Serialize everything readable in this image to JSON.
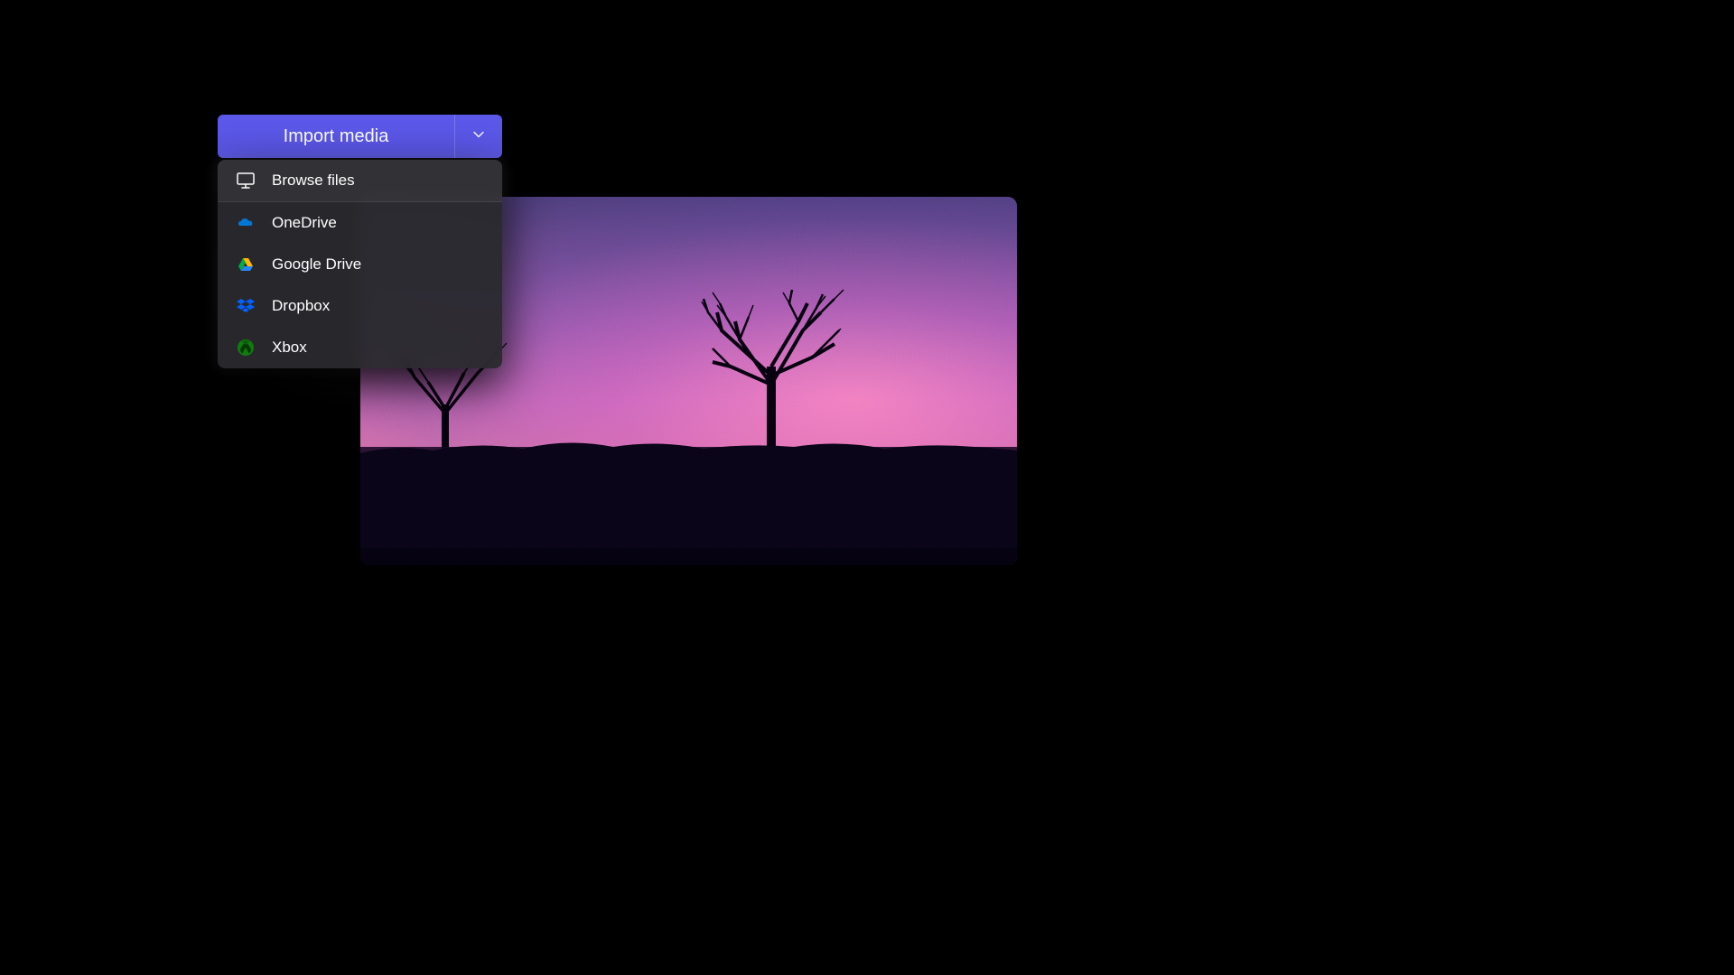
{
  "import_button": {
    "label": "Import media"
  },
  "dropdown": {
    "items": [
      {
        "label": "Browse files",
        "icon": "monitor"
      },
      {
        "label": "OneDrive",
        "icon": "onedrive"
      },
      {
        "label": "Google Drive",
        "icon": "googledrive"
      },
      {
        "label": "Dropbox",
        "icon": "dropbox"
      },
      {
        "label": "Xbox",
        "icon": "xbox"
      }
    ]
  },
  "colors": {
    "accent": "#5b57e8",
    "dropdown_bg": "#2a2a2e",
    "onedrive": "#0078d4",
    "dropbox": "#0061ff",
    "xbox": "#107c10"
  }
}
